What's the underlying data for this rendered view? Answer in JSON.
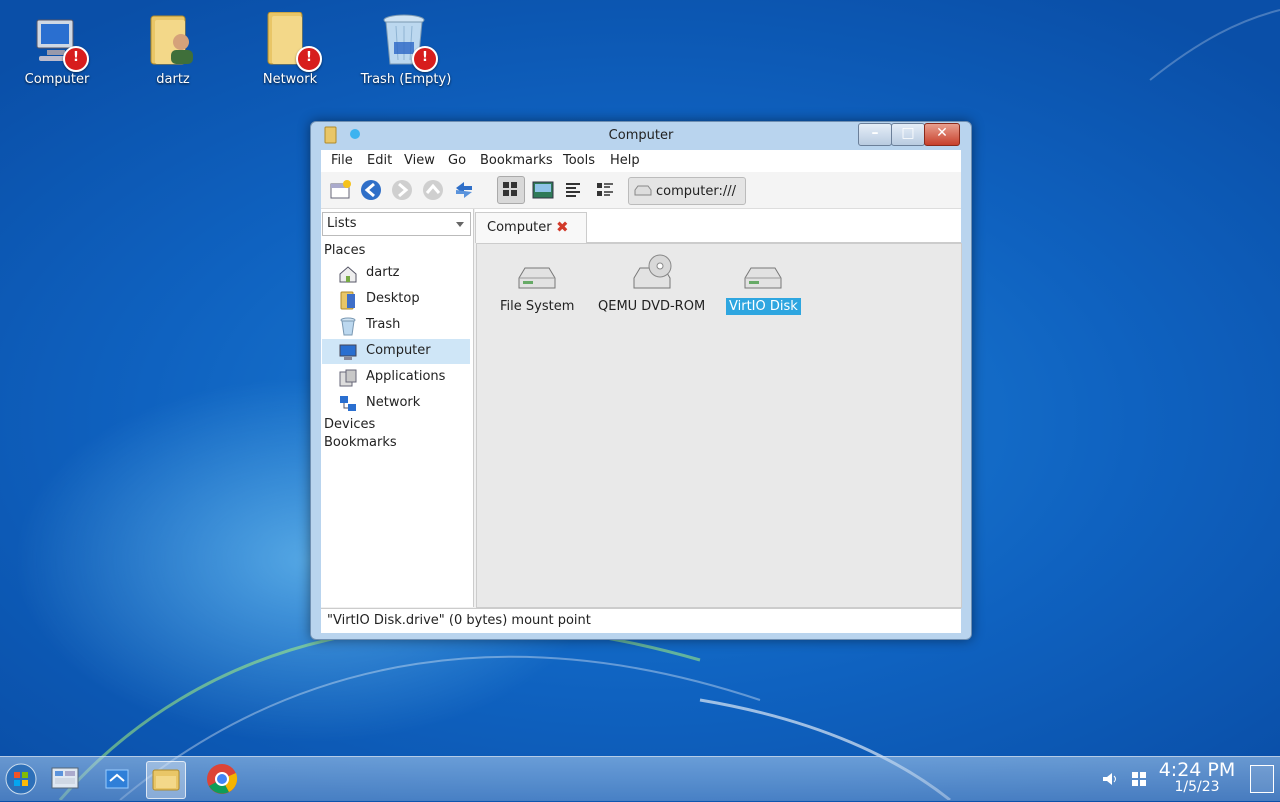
{
  "desktop": {
    "icons": [
      {
        "label": "Computer",
        "icon": "computer-icon"
      },
      {
        "label": "dartz",
        "icon": "user-folder-icon"
      },
      {
        "label": "Network",
        "icon": "network-folder-icon"
      },
      {
        "label": "Trash (Empty)",
        "icon": "trash-icon"
      }
    ],
    "badge_glyph": "!"
  },
  "window": {
    "title": "Computer",
    "menu": [
      "File",
      "Edit",
      "View",
      "Go",
      "Bookmarks",
      "Tools",
      "Help"
    ],
    "toolbar": {
      "buttons": [
        "new-window-icon",
        "back-icon",
        "forward-icon",
        "up-icon",
        "reload-icon",
        "icon-view-icon",
        "thumbnail-view-icon",
        "compact-view-icon",
        "detailed-view-icon"
      ],
      "pressed": "icon-view-icon",
      "address": "computer:///"
    },
    "side_panel": {
      "mode": "Lists",
      "places_heading": "Places",
      "places": [
        {
          "label": "dartz",
          "icon": "home-icon",
          "selected": false
        },
        {
          "label": "Desktop",
          "icon": "folder-icon",
          "selected": false
        },
        {
          "label": "Trash",
          "icon": "trash-icon",
          "selected": false
        },
        {
          "label": "Computer",
          "icon": "computer-icon",
          "selected": true
        },
        {
          "label": "Applications",
          "icon": "applications-icon",
          "selected": false
        },
        {
          "label": "Network",
          "icon": "network-icon",
          "selected": false
        }
      ],
      "devices_heading": "Devices",
      "bookmarks_heading": "Bookmarks"
    },
    "tab": {
      "label": "Computer",
      "close_glyph": "✖"
    },
    "items": [
      {
        "label": "File System",
        "icon": "drive-icon",
        "selected": false
      },
      {
        "label": "QEMU DVD-ROM",
        "icon": "optical-drive-icon",
        "selected": false
      },
      {
        "label": "VirtIO Disk",
        "icon": "drive-icon",
        "selected": true
      }
    ],
    "status": "\"VirtIO Disk.drive\" (0 bytes) mount point"
  },
  "taskbar": {
    "apps": [
      "start-orb-icon",
      "control-panel-icon",
      "desktop-switch-icon",
      "file-manager-icon",
      "chrome-icon"
    ],
    "active": "file-manager-icon",
    "tray": [
      "volume-icon",
      "windows-icon"
    ],
    "time": "4:24 PM",
    "date": "1/5/23"
  },
  "colors": {
    "selection": "#2ea6e0",
    "sidebar_selection": "#cfe6f7",
    "close_button": "#c7402c",
    "desktop": "#0f62c0"
  }
}
